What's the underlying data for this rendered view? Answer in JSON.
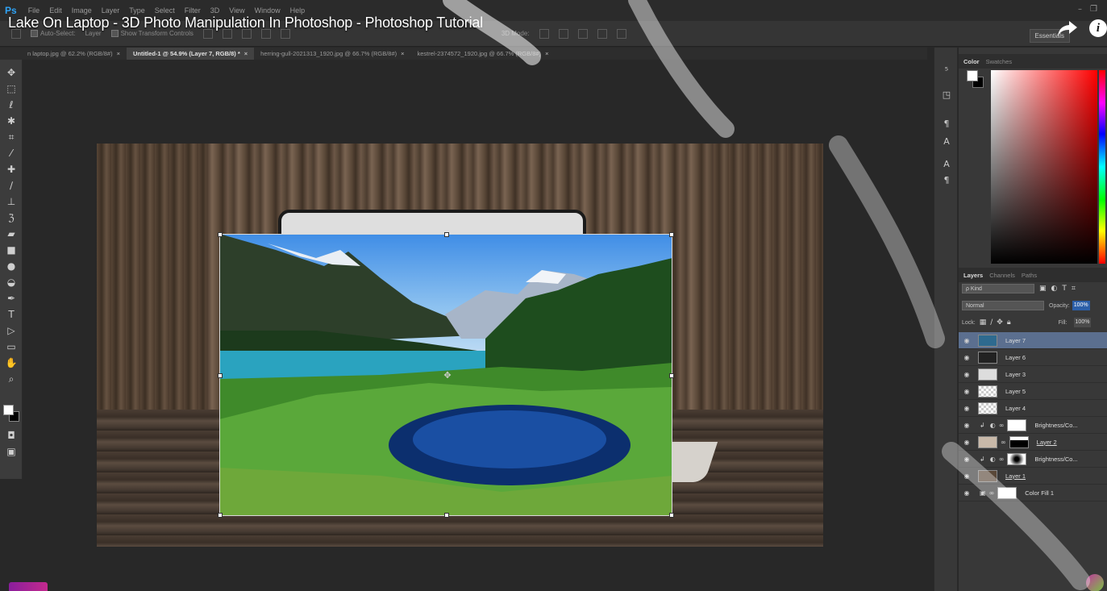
{
  "app": {
    "logo": "Ps"
  },
  "menu": [
    "File",
    "Edit",
    "Image",
    "Layer",
    "Type",
    "Select",
    "Filter",
    "3D",
    "View",
    "Window",
    "Help"
  ],
  "video": {
    "title": "Lake On Laptop - 3D Photo Manipulation In Photoshop - Photoshop Tutorial"
  },
  "options_bar": {
    "auto_select": "Auto-Select:",
    "auto_select_value": "Layer",
    "show_transform": "Show Transform Controls",
    "mode_3d": "3D Mode:",
    "workspace": "Essentials"
  },
  "tabs": [
    {
      "label": "n laptop.jpg @ 62.2% (RGB/8#)",
      "active": false
    },
    {
      "label": "Untitled-1 @ 54.9% (Layer 7, RGB/8) *",
      "active": true
    },
    {
      "label": "herring-gull-2021313_1920.jpg @ 66.7% (RGB/8#)",
      "active": false
    },
    {
      "label": "kestrel-2374572_1920.jpg @ 66.7% (RGB/8#)",
      "active": false
    }
  ],
  "tab_close": "×",
  "color_panel": {
    "tabs": [
      "Color",
      "Swatches"
    ],
    "fg": "#ffffff",
    "bg": "#000000"
  },
  "layers_panel": {
    "tabs": [
      "Layers",
      "Channels",
      "Paths"
    ],
    "filter_kind": "ρ Kind",
    "blend_mode": "Normal",
    "opacity_label": "Opacity:",
    "opacity_value": "100%",
    "lock_label": "Lock:",
    "fill_label": "Fill:",
    "fill_value": "100%",
    "layers": [
      {
        "name": "Layer 7",
        "selected": true,
        "kind": "image"
      },
      {
        "name": "Layer 6",
        "selected": false,
        "kind": "image"
      },
      {
        "name": "Layer 3",
        "selected": false,
        "kind": "image"
      },
      {
        "name": "Layer 5",
        "selected": false,
        "kind": "transparent"
      },
      {
        "name": "Layer 4",
        "selected": false,
        "kind": "transparent"
      },
      {
        "name": "Brightness/Co...",
        "selected": false,
        "kind": "adjustment"
      },
      {
        "name": "Layer 2",
        "selected": false,
        "kind": "masked"
      },
      {
        "name": "Brightness/Co...",
        "selected": false,
        "kind": "adjustment"
      },
      {
        "name": "Layer 1",
        "selected": false,
        "kind": "wood"
      },
      {
        "name": "Color Fill 1",
        "selected": false,
        "kind": "fill"
      }
    ]
  },
  "colors": {
    "accent": "#2fa3f6",
    "selected_layer": "#5b6f8f",
    "opacity_highlight": "#2c5fa8"
  },
  "icons": {
    "share": "share-arrow-icon",
    "info": "i"
  }
}
